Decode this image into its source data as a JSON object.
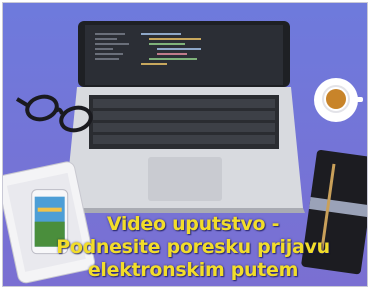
{
  "caption": {
    "line1": "Video uputstvo -",
    "line2": "Podnesite poresku prijavu",
    "line3": "elektronskim putem"
  },
  "colors": {
    "background": "#6b73d8",
    "caption_text": "#f2dd2a",
    "laptop_body": "#d9dbe0",
    "laptop_screen": "#2a2d33",
    "coffee": "#c8842a",
    "notebook": "#1f1f24"
  }
}
